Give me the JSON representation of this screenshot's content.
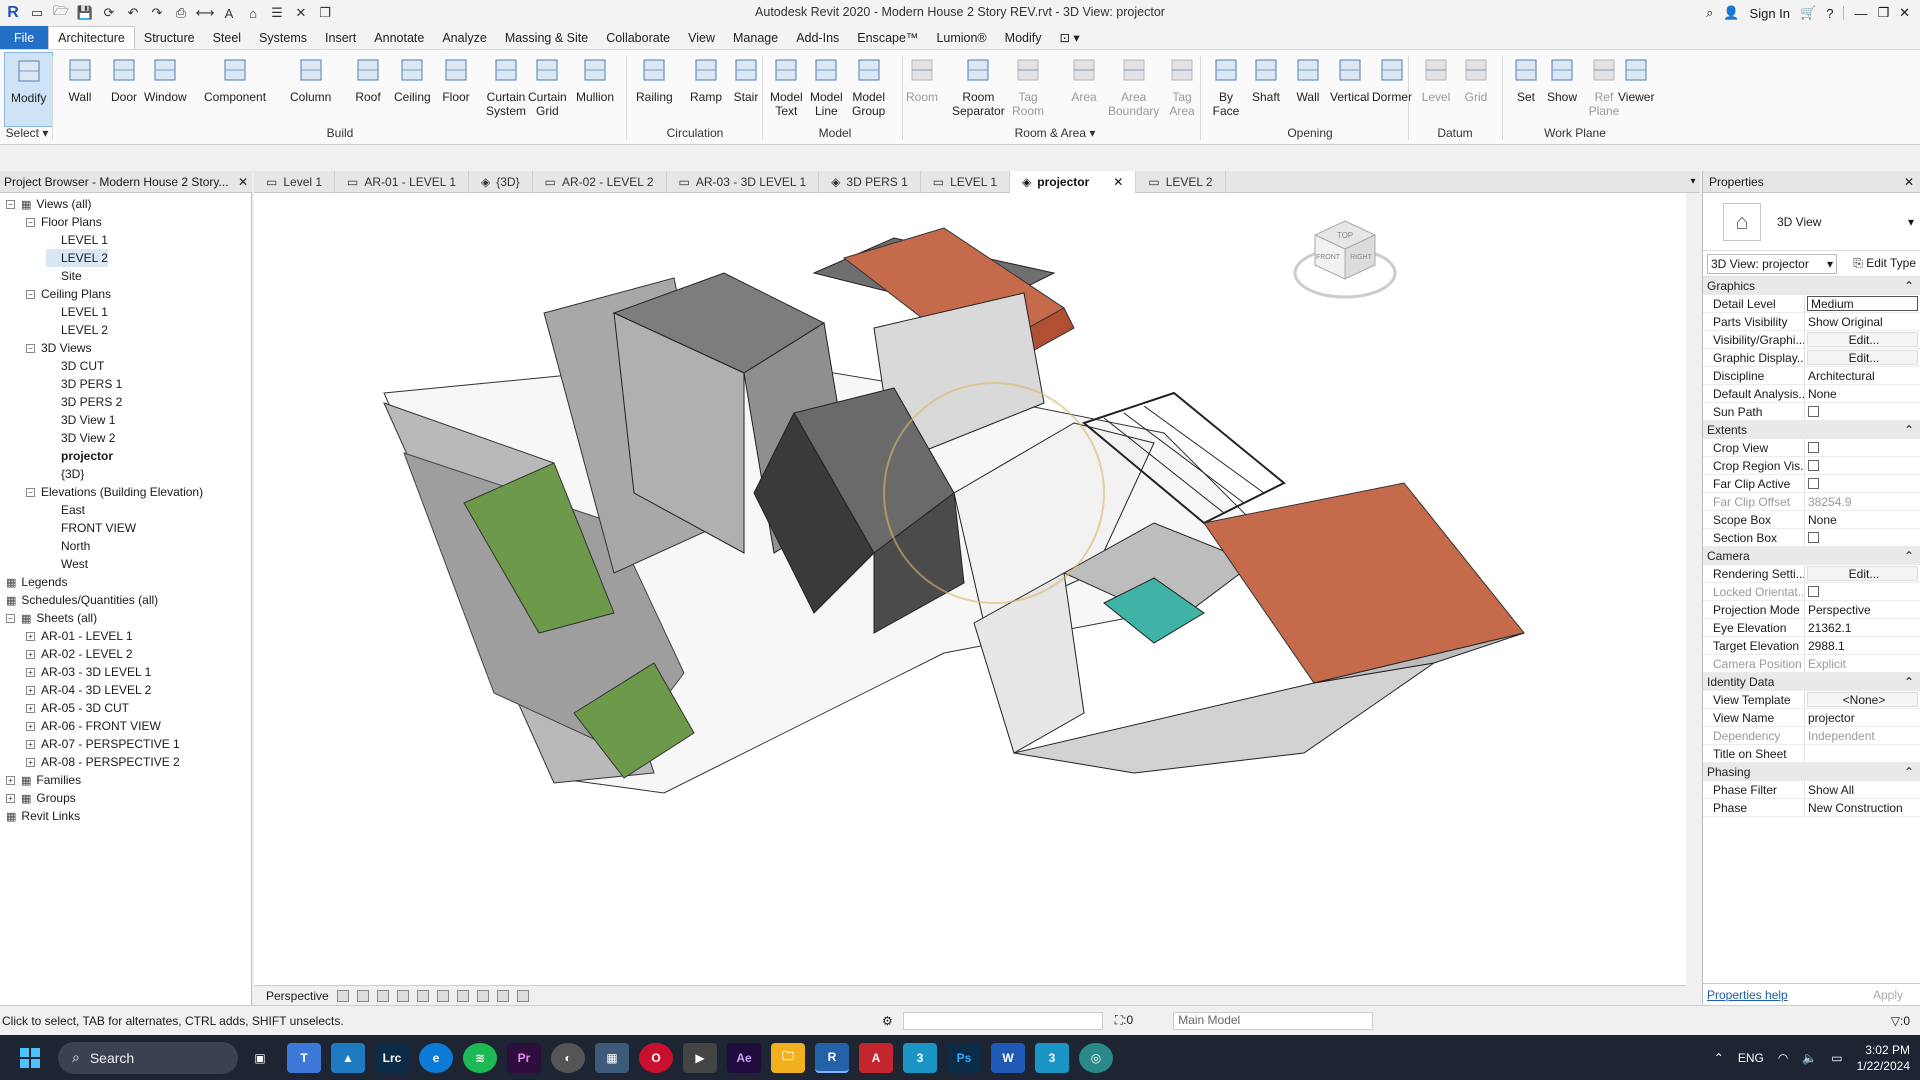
{
  "window": {
    "title": "Autodesk Revit 2020 - Modern House 2 Story REV.rvt - 3D View: projector",
    "sign_in": "Sign In"
  },
  "menu": [
    "File",
    "Architecture",
    "Structure",
    "Steel",
    "Systems",
    "Insert",
    "Annotate",
    "Analyze",
    "Massing & Site",
    "Collaborate",
    "View",
    "Manage",
    "Add-Ins",
    "Enscape™",
    "Lumion®",
    "Modify"
  ],
  "ribbon": {
    "tools": [
      {
        "label": "Modify",
        "icon": "cursor-icon"
      },
      {
        "label": "Wall",
        "icon": "wall-icon"
      },
      {
        "label": "Door",
        "icon": "door-icon"
      },
      {
        "label": "Window",
        "icon": "window-icon"
      },
      {
        "label": "Component",
        "icon": "component-icon"
      },
      {
        "label": "Column",
        "icon": "column-icon"
      },
      {
        "label": "Roof",
        "icon": "roof-icon"
      },
      {
        "label": "Ceiling",
        "icon": "ceiling-icon"
      },
      {
        "label": "Floor",
        "icon": "floor-icon"
      },
      {
        "label": "Curtain\nSystem",
        "icon": "curtain-system-icon"
      },
      {
        "label": "Curtain\nGrid",
        "icon": "curtain-grid-icon"
      },
      {
        "label": "Mullion",
        "icon": "mullion-icon"
      },
      {
        "label": "Railing",
        "icon": "railing-icon"
      },
      {
        "label": "Ramp",
        "icon": "ramp-icon"
      },
      {
        "label": "Stair",
        "icon": "stair-icon"
      },
      {
        "label": "Model\nText",
        "icon": "model-text-icon"
      },
      {
        "label": "Model\nLine",
        "icon": "model-line-icon"
      },
      {
        "label": "Model\nGroup",
        "icon": "model-group-icon"
      },
      {
        "label": "Room",
        "icon": "room-icon"
      },
      {
        "label": "Room\nSeparator",
        "icon": "room-separator-icon"
      },
      {
        "label": "Tag\nRoom",
        "icon": "tag-room-icon"
      },
      {
        "label": "Area",
        "icon": "area-icon"
      },
      {
        "label": "Area\nBoundary",
        "icon": "area-boundary-icon"
      },
      {
        "label": "Tag\nArea",
        "icon": "tag-area-icon"
      },
      {
        "label": "By\nFace",
        "icon": "by-face-icon"
      },
      {
        "label": "Shaft",
        "icon": "shaft-icon"
      },
      {
        "label": "Wall",
        "icon": "wall-opening-icon"
      },
      {
        "label": "Vertical",
        "icon": "vertical-icon"
      },
      {
        "label": "Dormer",
        "icon": "dormer-icon"
      },
      {
        "label": "Level",
        "icon": "level-icon"
      },
      {
        "label": "Grid",
        "icon": "grid-icon"
      },
      {
        "label": "Set",
        "icon": "set-icon"
      },
      {
        "label": "Show",
        "icon": "show-icon"
      },
      {
        "label": "Ref\nPlane",
        "icon": "ref-plane-icon"
      },
      {
        "label": "Viewer",
        "icon": "viewer-icon"
      }
    ],
    "groups": [
      "Select",
      "Build",
      "Circulation",
      "Model",
      "Room & Area",
      "Opening",
      "Datum",
      "Work Plane"
    ]
  },
  "browser": {
    "title": "Project Browser - Modern House 2 Story...",
    "nodes": [
      "Views (all)",
      "Floor Plans",
      "LEVEL 1",
      "LEVEL 2",
      "Site",
      "Ceiling Plans",
      "LEVEL 1",
      "LEVEL 2",
      "3D Views",
      "3D CUT",
      "3D PERS 1",
      "3D PERS 2",
      "3D View 1",
      "3D View 2",
      "projector",
      "{3D}",
      "Elevations (Building Elevation)",
      "East",
      "FRONT VIEW",
      "North",
      "West",
      "Legends",
      "Schedules/Quantities (all)",
      "Sheets (all)",
      "AR-01 - LEVEL 1",
      "AR-02 - LEVEL 2",
      "AR-03 - 3D LEVEL 1",
      "AR-04 - 3D LEVEL 2",
      "AR-05 - 3D CUT",
      "AR-06 - FRONT VIEW",
      "AR-07 - PERSPECTIVE 1",
      "AR-08 - PERSPECTIVE 2",
      "Families",
      "Groups",
      "Revit Links"
    ]
  },
  "tabs": [
    "Level 1",
    "AR-01 - LEVEL 1",
    "{3D}",
    "AR-02 - LEVEL 2",
    "AR-03 - 3D LEVEL 1",
    "3D PERS 1",
    "LEVEL 1",
    "projector",
    "LEVEL 2"
  ],
  "viewcube": {
    "top": "TOP",
    "front": "FRONT",
    "right": "RIGHT"
  },
  "view_control": {
    "mode": "Perspective"
  },
  "properties": {
    "title": "Properties",
    "type": "3D View",
    "instance": "3D View: projector",
    "edit_type": "Edit Type",
    "groups": [
      {
        "name": "Graphics",
        "rows": [
          {
            "k": "Detail Level",
            "v": "Medium"
          },
          {
            "k": "Parts Visibility",
            "v": "Show Original"
          },
          {
            "k": "Visibility/Graphi...",
            "v": "Edit..."
          },
          {
            "k": "Graphic Display...",
            "v": "Edit..."
          },
          {
            "k": "Discipline",
            "v": "Architectural"
          },
          {
            "k": "Default Analysis...",
            "v": "None"
          },
          {
            "k": "Sun Path",
            "v": ""
          }
        ]
      },
      {
        "name": "Extents",
        "rows": [
          {
            "k": "Crop View",
            "v": ""
          },
          {
            "k": "Crop Region Vis...",
            "v": ""
          },
          {
            "k": "Far Clip Active",
            "v": ""
          },
          {
            "k": "Far Clip Offset",
            "v": "38254.9"
          },
          {
            "k": "Scope Box",
            "v": "None"
          },
          {
            "k": "Section Box",
            "v": ""
          }
        ]
      },
      {
        "name": "Camera",
        "rows": [
          {
            "k": "Rendering Setti...",
            "v": "Edit..."
          },
          {
            "k": "Locked Orientat...",
            "v": ""
          },
          {
            "k": "Projection Mode",
            "v": "Perspective"
          },
          {
            "k": "Eye Elevation",
            "v": "21362.1"
          },
          {
            "k": "Target Elevation",
            "v": "2988.1"
          },
          {
            "k": "Camera Position",
            "v": "Explicit"
          }
        ]
      },
      {
        "name": "Identity Data",
        "rows": [
          {
            "k": "View Template",
            "v": "<None>"
          },
          {
            "k": "View Name",
            "v": "projector"
          },
          {
            "k": "Dependency",
            "v": "Independent"
          },
          {
            "k": "Title on Sheet",
            "v": ""
          }
        ]
      },
      {
        "name": "Phasing",
        "rows": [
          {
            "k": "Phase Filter",
            "v": "Show All"
          },
          {
            "k": "Phase",
            "v": "New Construction"
          }
        ]
      }
    ],
    "help": "Properties help",
    "apply": "Apply"
  },
  "status": {
    "hint": "Click to select, TAB for alternates, CTRL adds, SHIFT unselects.",
    "zero": ":0",
    "model": "Main Model",
    "filter": ":0"
  },
  "taskbar": {
    "search": "Search",
    "lang": "ENG",
    "time": "3:02 PM",
    "date": "1/22/2024"
  }
}
